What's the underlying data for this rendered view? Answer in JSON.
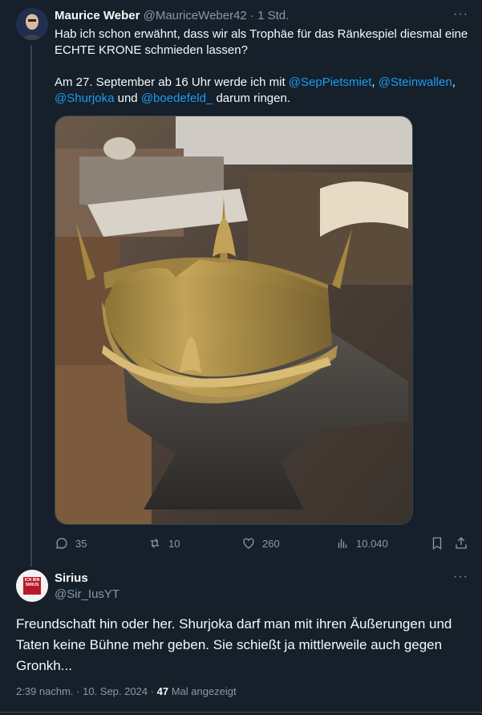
{
  "tweet": {
    "author_name": "Maurice Weber",
    "author_handle": "@MauriceWeber42",
    "separator": "·",
    "time": "1 Std.",
    "line1": "Hab ich schon erwähnt, dass wir als Trophäe für das Ränkespiel diesmal eine",
    "line2": "ECHTE KRONE schmieden lassen?",
    "line3_prefix": "Am 27. September ab 16 Uhr werde ich mit ",
    "mention1": "@SepPietsmiet",
    "comma1": ", ",
    "mention2": "@Steinwallen",
    "comma2": ",",
    "mention3": "@Shurjoka",
    "and_text": " und ",
    "mention4": "@boedefeld_",
    "line4_suffix": " darum ringen.",
    "more": "···",
    "stats": {
      "replies": "35",
      "retweets": "10",
      "likes": "260",
      "views": "10.040"
    }
  },
  "reply": {
    "author_name": "Sirius",
    "author_handle": "@Sir_IusYT",
    "more": "···",
    "line1": "Freundschaft hin oder her. Shurjoka darf man mit ihren Äußerungen und",
    "line2": "Taten keine Bühne mehr geben. Sie schießt ja mittlerweile auch gegen",
    "line3": "Gronkh...",
    "timestamp": "2:39 nachm. · 10. Sep. 2024 · ",
    "view_count": "47",
    "views_suffix": " Mal angezeigt",
    "avatar_text": "ICH BIN SIRIUS"
  },
  "colors": {
    "background": "#15202b",
    "text": "#f7f9f9",
    "muted": "#8b98a5",
    "link": "#1d9bf0"
  }
}
